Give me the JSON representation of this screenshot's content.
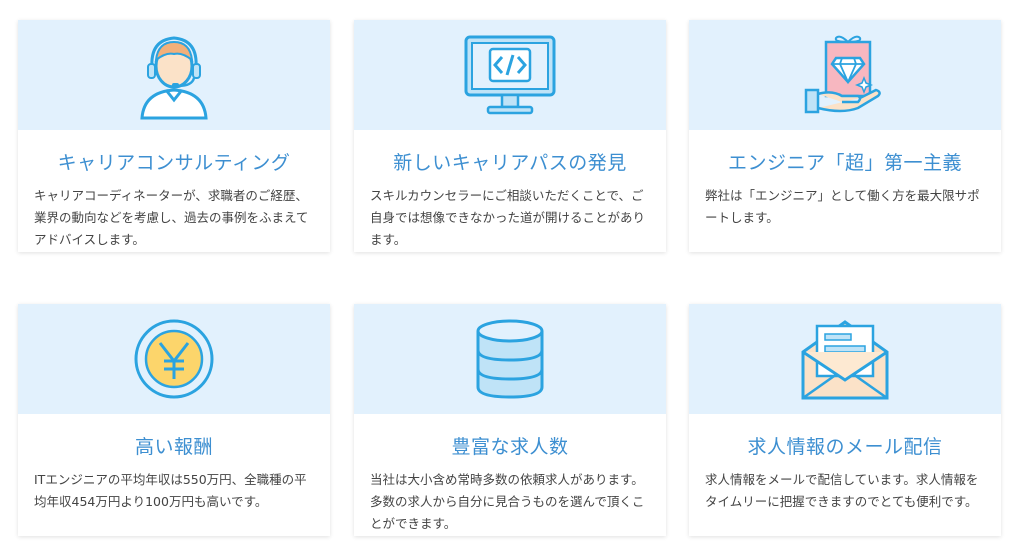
{
  "cards": [
    {
      "title": "キャリアコンサルティング",
      "description": "キャリアコーディネーターが、求職者のご経歴、業界の動向などを考慮し、過去の事例をふまえてアドバイスします。",
      "icon": "headset-consultant-icon"
    },
    {
      "title": "新しいキャリアパスの発見",
      "description": "スキルカウンセラーにご相談いただくことで、ご自身では想像できなかった道が開けることがあります。",
      "icon": "monitor-code-icon"
    },
    {
      "title": "エンジニア「超」第一主義",
      "description": "弊社は「エンジニア」として働く方を最大限サポートします。",
      "icon": "diamond-gift-hand-icon"
    },
    {
      "title": "高い報酬",
      "description": "ITエンジニアの平均年収は550万円、全職種の平均年収454万円より100万円も高いです。",
      "icon": "yen-coin-icon"
    },
    {
      "title": "豊富な求人数",
      "description": "当社は大小含め常時多数の依頼求人があります。多数の求人から自分に見合うものを選んで頂くことができます。",
      "icon": "database-icon"
    },
    {
      "title": "求人情報のメール配信",
      "description": "求人情報をメールで配信しています。求人情報をタイムリーに把握できますのでとても便利です。",
      "icon": "envelope-letter-icon"
    }
  ],
  "colors": {
    "accent": "#3d8fd1",
    "card_top_bg": "#e2f1fd",
    "icon_stroke": "#2ba3e0",
    "icon_fill_light": "#bfe3f7",
    "icon_yellow": "#fcd56b",
    "icon_pink": "#f7b7c0"
  }
}
